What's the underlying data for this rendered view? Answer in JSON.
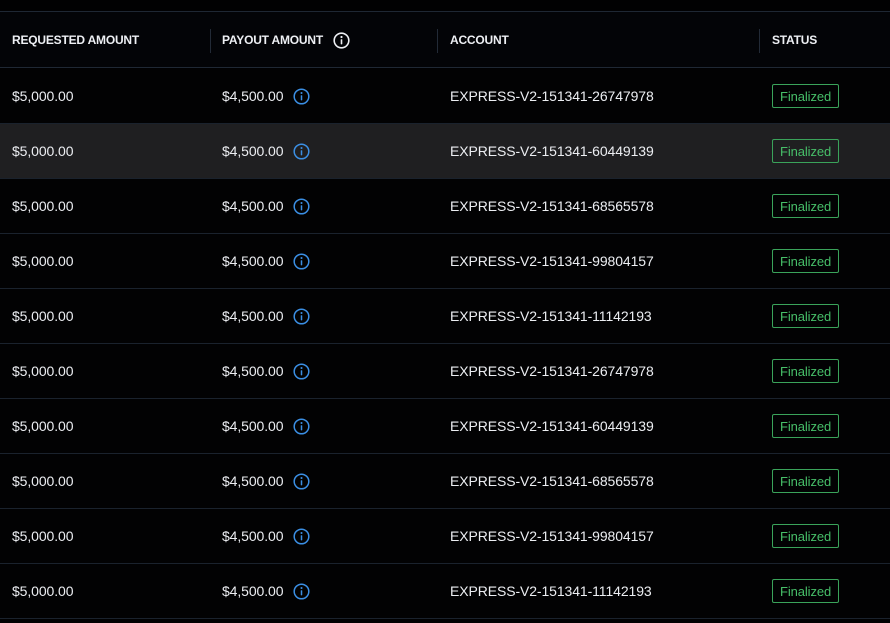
{
  "colors": {
    "background": "#010102",
    "row_highlight": "#1f1f21",
    "divider": "#1a222d",
    "status_finalized": "#47bf69",
    "info_icon": "#3b8fe4"
  },
  "table": {
    "columns": [
      {
        "key": "requested",
        "label": "REQUESTED AMOUNT"
      },
      {
        "key": "payout",
        "label": "PAYOUT AMOUNT",
        "icon": "info-icon"
      },
      {
        "key": "account",
        "label": "ACCOUNT"
      },
      {
        "key": "status",
        "label": "STATUS"
      }
    ],
    "rows": [
      {
        "requested": "$5,000.00",
        "payout": "$4,500.00",
        "account": "EXPRESS-V2-151341-26747978",
        "status": "Finalized"
      },
      {
        "requested": "$5,000.00",
        "payout": "$4,500.00",
        "account": "EXPRESS-V2-151341-60449139",
        "status": "Finalized"
      },
      {
        "requested": "$5,000.00",
        "payout": "$4,500.00",
        "account": "EXPRESS-V2-151341-68565578",
        "status": "Finalized"
      },
      {
        "requested": "$5,000.00",
        "payout": "$4,500.00",
        "account": "EXPRESS-V2-151341-99804157",
        "status": "Finalized"
      },
      {
        "requested": "$5,000.00",
        "payout": "$4,500.00",
        "account": "EXPRESS-V2-151341-11142193",
        "status": "Finalized"
      },
      {
        "requested": "$5,000.00",
        "payout": "$4,500.00",
        "account": "EXPRESS-V2-151341-26747978",
        "status": "Finalized"
      },
      {
        "requested": "$5,000.00",
        "payout": "$4,500.00",
        "account": "EXPRESS-V2-151341-60449139",
        "status": "Finalized"
      },
      {
        "requested": "$5,000.00",
        "payout": "$4,500.00",
        "account": "EXPRESS-V2-151341-68565578",
        "status": "Finalized"
      },
      {
        "requested": "$5,000.00",
        "payout": "$4,500.00",
        "account": "EXPRESS-V2-151341-99804157",
        "status": "Finalized"
      },
      {
        "requested": "$5,000.00",
        "payout": "$4,500.00",
        "account": "EXPRESS-V2-151341-11142193",
        "status": "Finalized"
      }
    ]
  }
}
